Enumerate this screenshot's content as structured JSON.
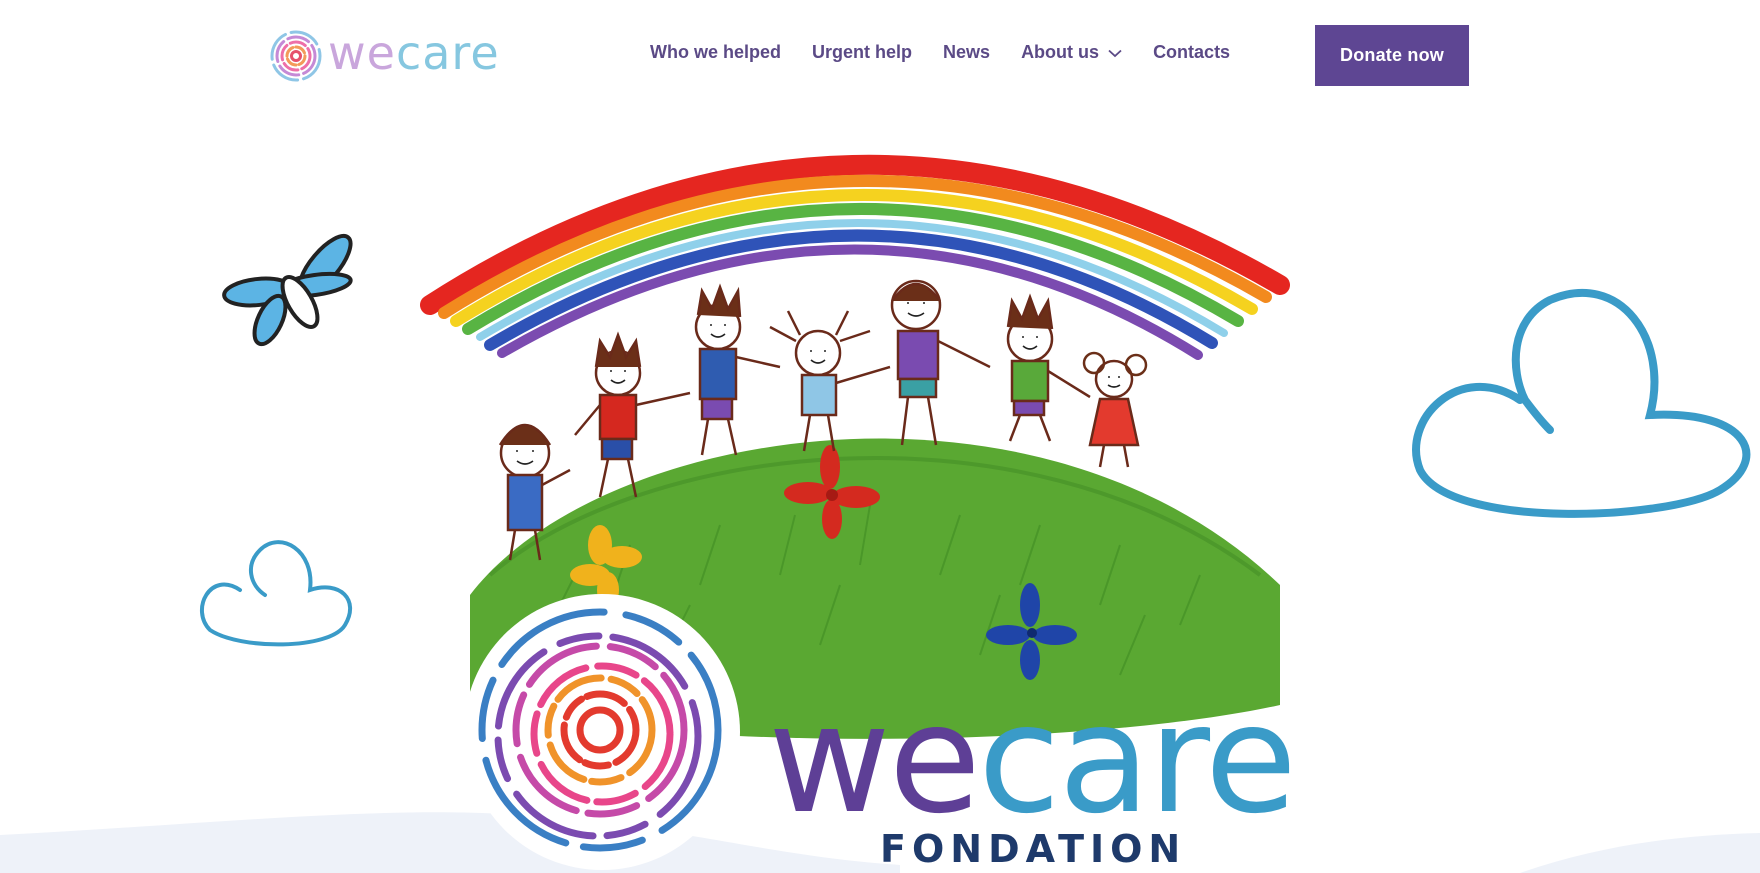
{
  "header": {
    "logo": {
      "we": "we",
      "care": "care"
    },
    "nav": [
      {
        "label": "Who we helped"
      },
      {
        "label": "Urgent help"
      },
      {
        "label": "News"
      },
      {
        "label": "About us",
        "has_dropdown": true
      },
      {
        "label": "Contacts"
      }
    ],
    "donate_label": "Donate now"
  },
  "hero": {
    "brand": {
      "we": "we",
      "care": "care",
      "subtitle": "FONDATION"
    },
    "illustration": "children-holding-hands-under-rainbow",
    "decorations": [
      "dragonfly-icon",
      "cloud-icon",
      "cloud-icon"
    ]
  },
  "colors": {
    "accent": "#5e4693",
    "nav_text": "#5b4a86",
    "cloud": "#3a9bc8",
    "brand_we": "#5e3f96",
    "brand_care": "#3a9bc8",
    "brand_sub": "#1e3a6b"
  }
}
